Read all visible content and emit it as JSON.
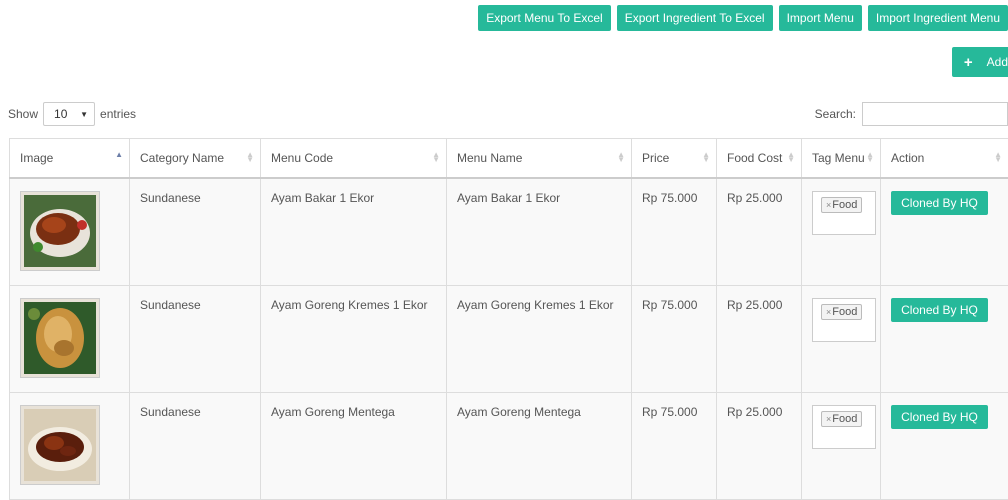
{
  "toolbar": {
    "export_menu": "Export Menu To Excel",
    "export_ingredient": "Export Ingredient To Excel",
    "import_menu": "Import Menu",
    "import_ingredient": "Import Ingredient Menu",
    "add": "Add"
  },
  "length": {
    "show": "Show",
    "value": "10",
    "entries": "entries"
  },
  "search": {
    "label": "Search:",
    "value": ""
  },
  "columns": [
    "Image",
    "Category Name",
    "Menu Code",
    "Menu Name",
    "Price",
    "Food Cost",
    "Tag Menu",
    "Action"
  ],
  "rows": [
    {
      "category": "Sundanese",
      "code": "Ayam Bakar 1 Ekor",
      "name": "Ayam Bakar 1 Ekor",
      "price": "Rp 75.000",
      "cost": "Rp 25.000",
      "tag": "Food",
      "action": "Cloned By HQ"
    },
    {
      "category": "Sundanese",
      "code": "Ayam Goreng Kremes 1 Ekor",
      "name": "Ayam Goreng Kremes 1 Ekor",
      "price": "Rp 75.000",
      "cost": "Rp 25.000",
      "tag": "Food",
      "action": "Cloned By HQ"
    },
    {
      "category": "Sundanese",
      "code": "Ayam Goreng Mentega",
      "name": "Ayam Goreng Mentega",
      "price": "Rp 75.000",
      "cost": "Rp 25.000",
      "tag": "Food",
      "action": "Cloned By HQ"
    }
  ],
  "colors": {
    "accent": "#26b99a"
  }
}
